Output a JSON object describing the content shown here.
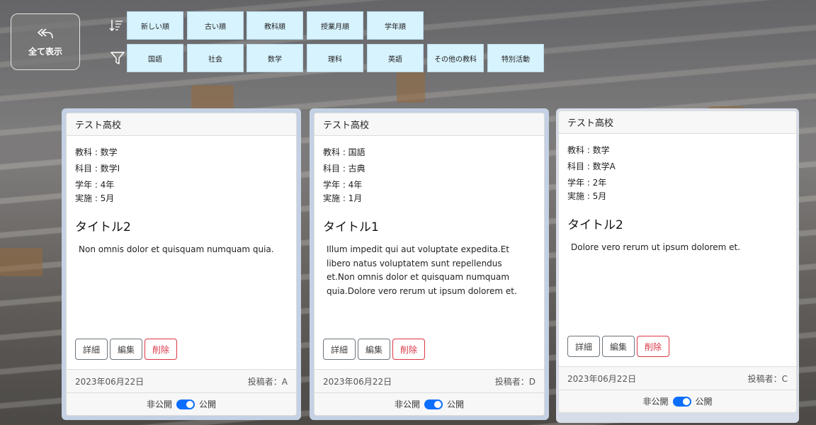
{
  "toolbar": {
    "show_all_label": "全て表示",
    "sort_options": [
      "新しい順",
      "古い順",
      "教科順",
      "授業月順",
      "学年順"
    ],
    "filter_options": [
      "国語",
      "社会",
      "数学",
      "理科",
      "英語",
      "その他の教科",
      "特別活動"
    ]
  },
  "cards": [
    {
      "school": "テスト高校",
      "subject": "教科 : 数学",
      "course": "科目 : 数学I",
      "grade": "学年 : 4年",
      "month": "実施 : 5月",
      "title": "タイトル2",
      "text": "Non omnis dolor et quisquam numquam quia.",
      "detail_label": "詳細",
      "edit_label": "編集",
      "delete_label": "削除",
      "date": "2023年06月22日",
      "author": "投稿者：A",
      "private_label": "非公開",
      "public_label": "公開"
    },
    {
      "school": "テスト高校",
      "subject": "教科 : 国語",
      "course": "科目 : 古典",
      "grade": "学年 : 4年",
      "month": "実施 : 1月",
      "title": "タイトル1",
      "text": "Illum impedit qui aut voluptate expedita.Et libero natus voluptatem sunt repellendus et.Non omnis dolor et quisquam numquam quia.Dolore vero rerum ut ipsum dolorem et.",
      "detail_label": "詳細",
      "edit_label": "編集",
      "delete_label": "削除",
      "date": "2023年06月22日",
      "author": "投稿者：D",
      "private_label": "非公開",
      "public_label": "公開"
    },
    {
      "school": "テスト高校",
      "subject": "教科 : 数学",
      "course": "科目 : 数学A",
      "grade": "学年 : 2年",
      "month": "実施 : 5月",
      "title": "タイトル2",
      "text": "Dolore vero rerum ut ipsum dolorem et.",
      "detail_label": "詳細",
      "edit_label": "編集",
      "delete_label": "削除",
      "date": "2023年06月22日",
      "author": "投稿者：C",
      "private_label": "非公開",
      "public_label": "公開"
    }
  ],
  "colors": {
    "chip_bg": "#d7f3fe",
    "card_border": "#c4d1e4",
    "switch_on": "#0d6efd",
    "danger": "#dc3545"
  },
  "icons": {
    "show_all": "undo-all-icon",
    "sort": "sort-descending-icon",
    "filter": "filter-funnel-icon"
  }
}
